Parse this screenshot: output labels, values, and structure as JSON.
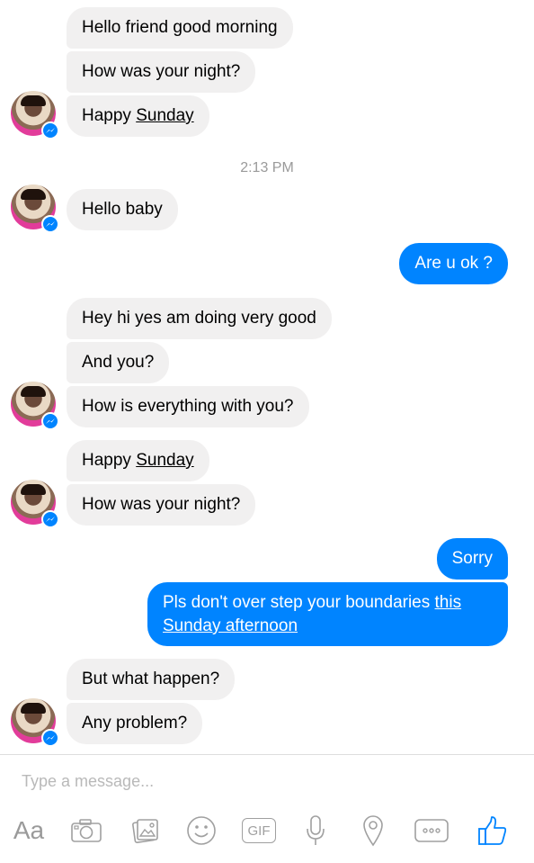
{
  "messages": {
    "m1": "Hello friend good morning",
    "m2": "How was your night?",
    "m3_a": "Happy ",
    "m3_b": "Sunday",
    "timestamp": "2:13 PM",
    "m4": "Hello baby",
    "m5": "Are u ok ?",
    "m6": "Hey hi yes am doing very good",
    "m7": "And you?",
    "m8": "How is everything with you?",
    "m9_a": "Happy ",
    "m9_b": "Sunday",
    "m10": "How was your night?",
    "m11": "Sorry",
    "m12_a": "Pls don't over step your boundaries ",
    "m12_b": "this",
    "m12_c": "Sunday afternoon",
    "m13": "But what happen?",
    "m14": "Any problem?"
  },
  "composer": {
    "placeholder": "Type a message...",
    "text_icon_label": "Aa",
    "gif_label": "GIF"
  },
  "colors": {
    "outgoing": "#0084ff",
    "incoming": "#f1f0f0",
    "accent": "#0084ff"
  },
  "icons": [
    "text-format-icon",
    "camera-icon",
    "gallery-icon",
    "emoji-icon",
    "gif-icon",
    "microphone-icon",
    "location-icon",
    "more-icon",
    "thumbs-up-icon"
  ]
}
